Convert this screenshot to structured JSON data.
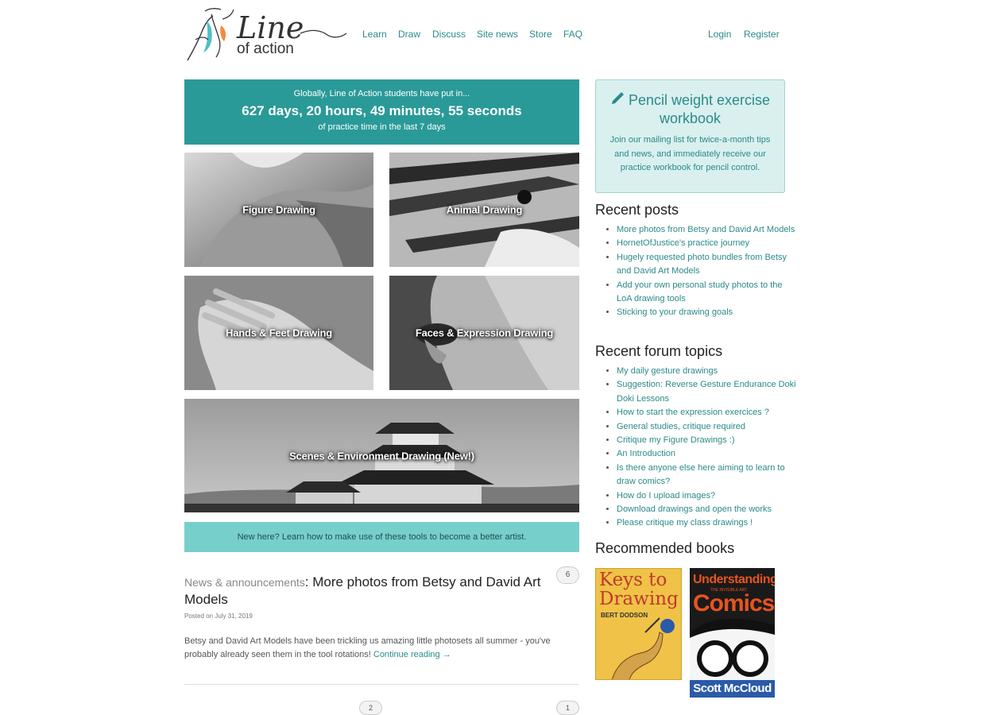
{
  "header": {
    "logo_line1": "Line",
    "logo_line2": "of action",
    "nav": [
      "Learn",
      "Draw",
      "Discuss",
      "Site news",
      "Store",
      "FAQ"
    ],
    "login": "Login",
    "register": "Register"
  },
  "stats": {
    "line1": "Globally, Line of Action students have put in...",
    "line2": "627 days, 20 hours, 49 minutes, 55 seconds",
    "line3": "of practice time in the last 7 days"
  },
  "tiles": [
    "Figure Drawing",
    "Animal Drawing",
    "Hands & Feet Drawing",
    "Faces & Expression Drawing",
    "Scenes & Environment Drawing (New!)"
  ],
  "new_here": "New here? Learn how to make use of these tools to become a better artist.",
  "post": {
    "category": "News & announcements",
    "title": "More photos from Betsy and David Art Models",
    "comments": "6",
    "date": "Posted on July 31, 2019",
    "body": "Betsy and David Art Models have been trickling us amazing little photosets all summer - you've probably already seen them in the tool rotations!",
    "continue": "Continue reading →"
  },
  "next_post_counts": [
    "2",
    "1"
  ],
  "promo": {
    "icon": "pencil-icon",
    "title": "Pencil weight exercise workbook",
    "desc": "Join our mailing list for twice-a-month tips and news, and immediately receive our practice workbook for pencil control."
  },
  "recent_posts": {
    "heading": "Recent posts",
    "items": [
      "More photos from Betsy and David Art Models",
      "HornetOfJustice's practice journey",
      "Hugely requested photo bundles from Betsy and David Art Models",
      "Add your own personal study photos to the LoA drawing tools",
      "Sticking to your drawing goals"
    ]
  },
  "recent_topics": {
    "heading": "Recent forum topics",
    "items": [
      "My daily gesture drawings",
      "Suggestion: Reverse Gesture Endurance Doki Doki Lessons",
      "How to start the expression exercices ?",
      "General studies, critique required",
      "Critique my Figure Drawings :)",
      "An Introduction",
      "Is there anyone else here aiming to learn to draw comics?",
      "How do I upload images?",
      "Download drawings and open the works",
      "Please critique my class drawings !"
    ]
  },
  "books": {
    "heading": "Recommended books",
    "book1_title_1": "Keys to",
    "book1_title_2": "Drawing",
    "book1_author": "BERT DODSON",
    "book2_title_1": "Understanding",
    "book2_title_2": "Comics",
    "book2_subtitle": "THE INVISIBLE ART",
    "book2_author": "Scott McCloud"
  },
  "colors": {
    "accent": "#2a9a98",
    "link": "#2b8a89",
    "light_banner": "#77cfcc",
    "promo_bg": "#d9f0ef"
  }
}
